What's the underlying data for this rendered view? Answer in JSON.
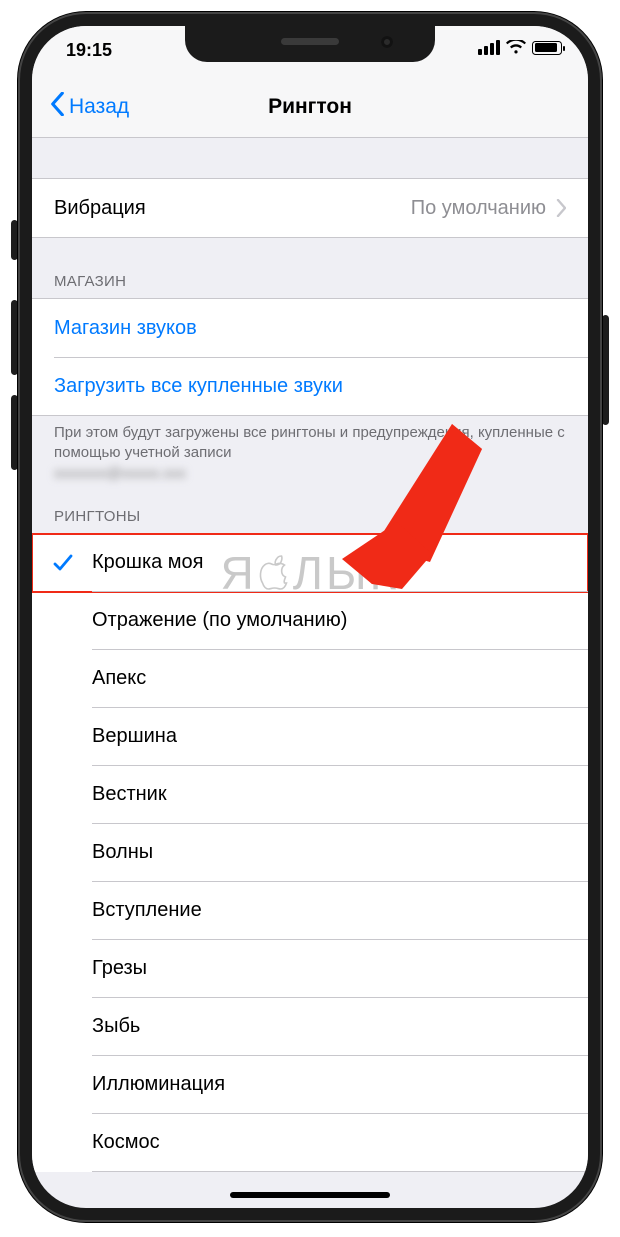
{
  "status": {
    "time": "19:15"
  },
  "nav": {
    "back": "Назад",
    "title": "Рингтон"
  },
  "vibration": {
    "label": "Вибрация",
    "value": "По умолчанию"
  },
  "store": {
    "header": "МАГАЗИН",
    "sound_store": "Магазин звуков",
    "download_all": "Загрузить все купленные звуки",
    "footer_line1": "При этом будут загружены все рингтоны и предупреждения, купленные с помощью учетной записи",
    "footer_blurred": "xxxxxxx@xxxxx.xxx"
  },
  "ringtones": {
    "header": "РИНГТОНЫ",
    "items": [
      {
        "label": "Крошка моя",
        "selected": true
      },
      {
        "label": "Отражение (по умолчанию)",
        "selected": false
      },
      {
        "label": "Апекс",
        "selected": false
      },
      {
        "label": "Вершина",
        "selected": false
      },
      {
        "label": "Вестник",
        "selected": false
      },
      {
        "label": "Волны",
        "selected": false
      },
      {
        "label": "Вступление",
        "selected": false
      },
      {
        "label": "Грезы",
        "selected": false
      },
      {
        "label": "Зыбь",
        "selected": false
      },
      {
        "label": "Иллюминация",
        "selected": false
      },
      {
        "label": "Космос",
        "selected": false
      }
    ]
  },
  "annotation": {
    "arrow_color": "#f02a17"
  },
  "watermark": {
    "left": "Я",
    "right": "ЛЫК"
  }
}
